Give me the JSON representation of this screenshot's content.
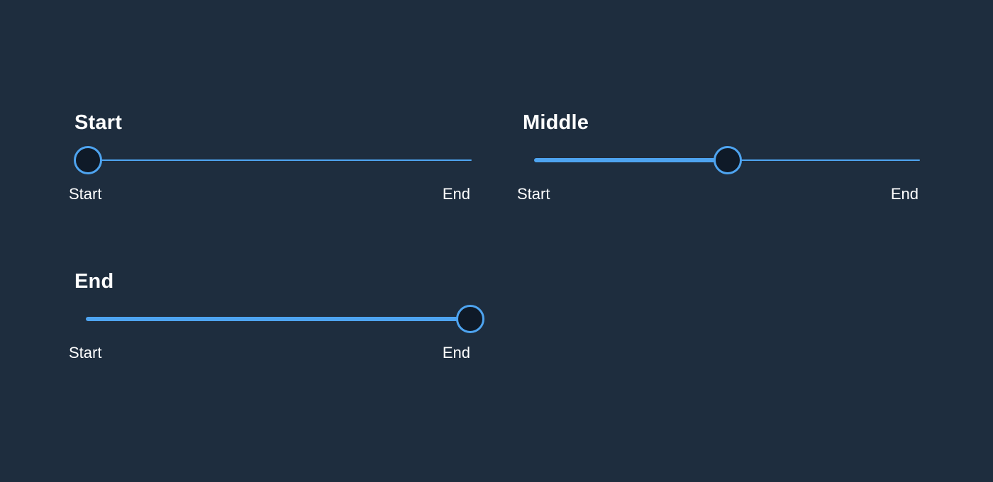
{
  "colors": {
    "background": "#1e2d3e",
    "accent": "#4ea4f0",
    "thumb_fill": "#0f1a28",
    "text": "#ffffff"
  },
  "sliders": [
    {
      "title": "Start",
      "value": 0.0,
      "start_label": "Start",
      "end_label": "End"
    },
    {
      "title": "Middle",
      "value": 0.5,
      "start_label": "Start",
      "end_label": "End"
    },
    {
      "title": "End",
      "value": 1.0,
      "start_label": "Start",
      "end_label": "End"
    }
  ]
}
